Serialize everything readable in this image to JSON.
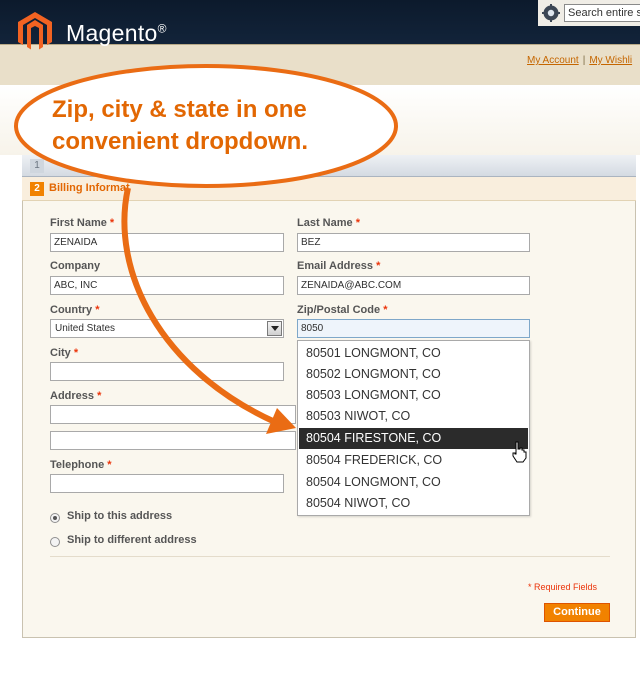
{
  "header": {
    "brand": "Magento",
    "brand_mark": "®",
    "search_placeholder": "Search entire s",
    "links": [
      "My Account",
      "My Wishli"
    ],
    "link_separator": "|"
  },
  "checkout": {
    "step1_number": "1",
    "step2_number": "2",
    "step2_title": "Billing Informat",
    "required_mark": "*",
    "fields": {
      "first_name": {
        "label": "First Name",
        "value": "ZENAIDA"
      },
      "last_name": {
        "label": "Last Name",
        "value": "BEZ"
      },
      "company": {
        "label": "Company",
        "value": "ABC, INC"
      },
      "email": {
        "label": "Email Address",
        "value": "ZENAIDA@ABC.COM"
      },
      "country": {
        "label": "Country",
        "value": "United States"
      },
      "zip": {
        "label": "Zip/Postal Code",
        "value": "8050"
      },
      "city": {
        "label": "City",
        "value": ""
      },
      "address": {
        "label": "Address",
        "value": ""
      },
      "telephone": {
        "label": "Telephone",
        "value": ""
      }
    },
    "zip_suggestions": [
      "80501 LONGMONT, CO",
      "80502 LONGMONT, CO",
      "80503 LONGMONT, CO",
      "80503 NIWOT, CO",
      "80504 FIRESTONE, CO",
      "80504 FREDERICK, CO",
      "80504 LONGMONT, CO",
      "80504 NIWOT, CO"
    ],
    "selected_suggestion_index": 4,
    "ship_options": [
      {
        "label": "Ship to this address",
        "checked": true
      },
      {
        "label": "Ship to different address",
        "checked": false
      }
    ],
    "required_note": "* Required Fields",
    "continue_label": "Continue"
  },
  "callout": {
    "line1": "Zip, city & state in one",
    "line2": "convenient dropdown."
  },
  "colors": {
    "accent_orange": "#e26703",
    "button_orange": "#f18200",
    "required_red": "#eb340a",
    "header_dark": "#13253c"
  },
  "icons": [
    "magento-logo-icon",
    "search-icon",
    "select-arrow-icon",
    "pointer-cursor-icon"
  ]
}
